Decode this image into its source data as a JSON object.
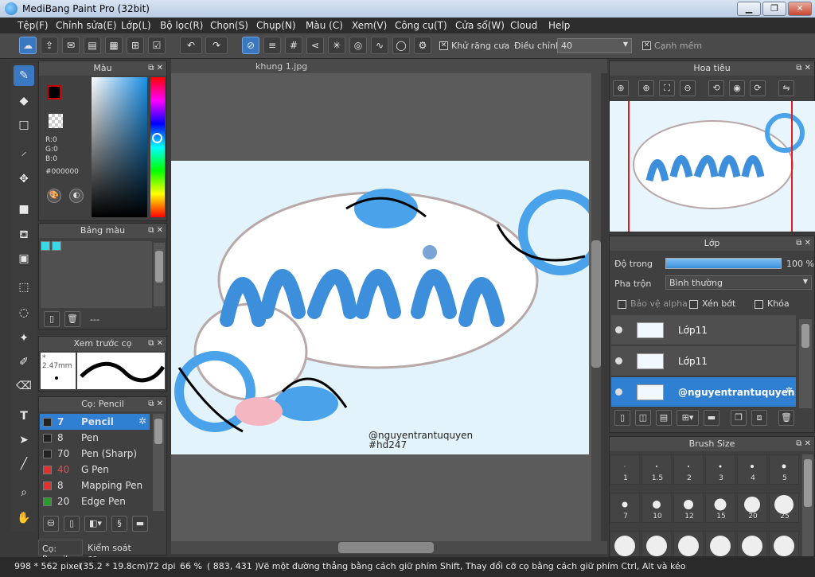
{
  "app": {
    "title": "MediBang Paint Pro (32bit)"
  },
  "menu": [
    "Tệp(F)",
    "Chỉnh sửa(E)",
    "Lớp(L)",
    "Bộ lọc(R)",
    "Chọn(S)",
    "Chụp(N)",
    "Màu (C)",
    "Xem(V)",
    "Công cụ(T)",
    "Cửa sổ(W)",
    "Cloud",
    "Help"
  ],
  "toolbar": {
    "antialias_label": "Khử răng cưa",
    "adjust_label": "Điều chỉnh",
    "adjust_value": "40",
    "edge_label": "Cạnh mềm"
  },
  "color_panel": {
    "title": "Màu",
    "r": "R:0",
    "g": "G:0",
    "b": "B:0",
    "hex": "#000000"
  },
  "palette_panel": {
    "title": "Bảng màu",
    "dash": "---",
    "swatches": [
      "#3ad7e6",
      "#3ad7e6"
    ]
  },
  "brush_preview": {
    "title": "Xem trước cọ",
    "size": "2.47mm"
  },
  "brush_panel": {
    "title": "Cọ: Pencil",
    "items": [
      {
        "size": "7",
        "name": "Pencil",
        "color": "#222222",
        "selected": true
      },
      {
        "size": "8",
        "name": "Pen",
        "color": "#222222"
      },
      {
        "size": "70",
        "name": "Pen (Sharp)",
        "color": "#222222"
      },
      {
        "size": "40",
        "name": "G Pen",
        "color": "#e03030"
      },
      {
        "size": "8",
        "name": "Mapping Pen",
        "color": "#e03030"
      },
      {
        "size": "20",
        "name": "Edge Pen",
        "color": "#2a9a2a"
      }
    ],
    "tab_brush": "Cọ: Pencil",
    "tab_control": "Kiểm soát cọ"
  },
  "document": {
    "tab": "khung 1.jpg",
    "watermark_line1": "@nguyentrantuquyen",
    "watermark_line2": "#hd247"
  },
  "navigator": {
    "title": "Hoa tiêu"
  },
  "layer_panel": {
    "title": "Lớp",
    "opacity_label": "Độ trong",
    "opacity_value": "100 %",
    "blend_label": "Pha trộn",
    "blend_value": "Bình thường",
    "protect_alpha": "Bảo vệ alpha",
    "clip": "Xén bớt",
    "lock": "Khóa",
    "layers": [
      {
        "name": "Lớp11",
        "selected": false
      },
      {
        "name": "Lớp11",
        "selected": false
      },
      {
        "name": "@nguyentrantuquyen",
        "selected": true
      }
    ]
  },
  "brush_size_panel": {
    "title": "Brush Size",
    "sizes": [
      "1",
      "1.5",
      "2",
      "3",
      "4",
      "5",
      "7",
      "10",
      "12",
      "15",
      "20",
      "25"
    ]
  },
  "status": {
    "dims": "998 * 562 pixel",
    "cm": "(35.2 * 19.8cm)",
    "dpi": "72 dpi",
    "zoom": "66 %",
    "coords": "( 883, 431 )",
    "hint": "Vẽ một đường thẳng bằng cách giữ phím Shift, Thay đổi cỡ cọ bằng cách giữ phím Ctrl, Alt và kéo"
  }
}
